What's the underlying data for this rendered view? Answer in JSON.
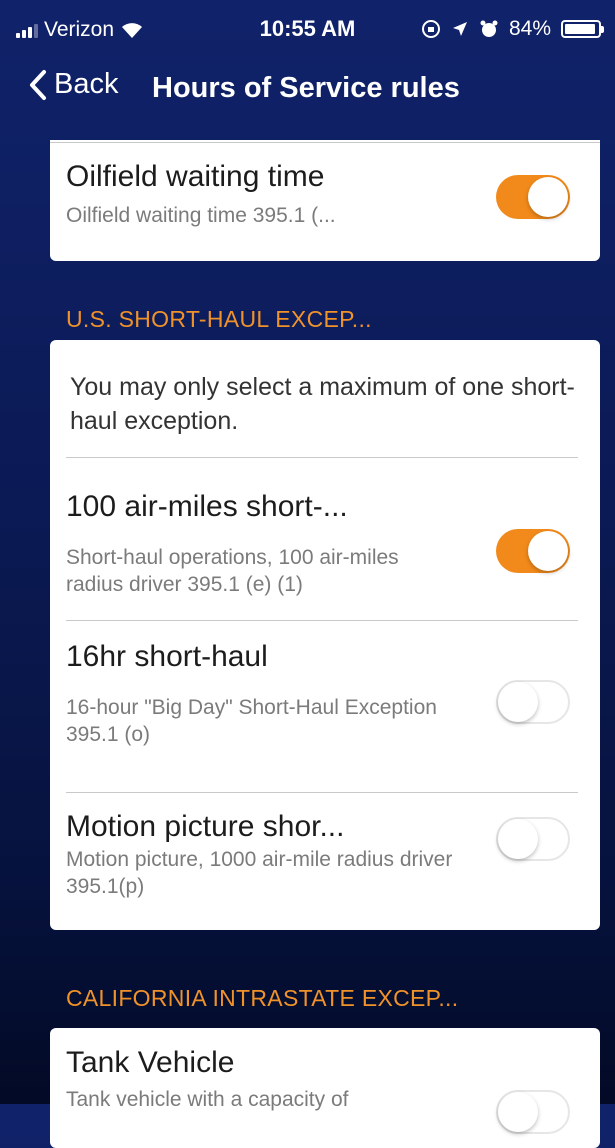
{
  "status_bar": {
    "carrier": "Verizon",
    "time": "10:55 AM",
    "battery": "84%",
    "battery_level": 0.84,
    "icons": [
      "signal-icon",
      "wifi-icon",
      "orientation-lock-icon",
      "location-icon",
      "alarm-icon",
      "battery-icon"
    ]
  },
  "nav": {
    "back_label": "Back",
    "title": "Hours of Service rules"
  },
  "oilfield": {
    "title": "Oilfield waiting time",
    "subtitle": "Oilfield waiting time 395.1 (...",
    "enabled": true
  },
  "us_short_haul": {
    "header": "U.S. SHORT-HAUL EXCEP...",
    "note": "You may only select a maximum of one short-haul exception.",
    "items": [
      {
        "title": "100 air-miles short-...",
        "subtitle": "Short-haul operations, 100 air-miles radius driver 395.1 (e) (1)",
        "enabled": true
      },
      {
        "title": "16hr short-haul",
        "subtitle": "16-hour \"Big Day\" Short-Haul Exception 395.1 (o)",
        "enabled": false
      },
      {
        "title": "Motion picture shor...",
        "subtitle": "Motion picture, 1000 air-mile radius driver 395.1(p)",
        "enabled": false
      }
    ]
  },
  "california": {
    "header": "CALIFORNIA INTRASTATE EXCEP...",
    "items": [
      {
        "title": "Tank Vehicle",
        "subtitle": "Tank vehicle with a capacity of",
        "enabled": false
      }
    ]
  },
  "colors": {
    "accent": "#f28a1b",
    "section_header": "#f0922a",
    "background_top": "#10226a",
    "background_bottom": "#030a26"
  }
}
